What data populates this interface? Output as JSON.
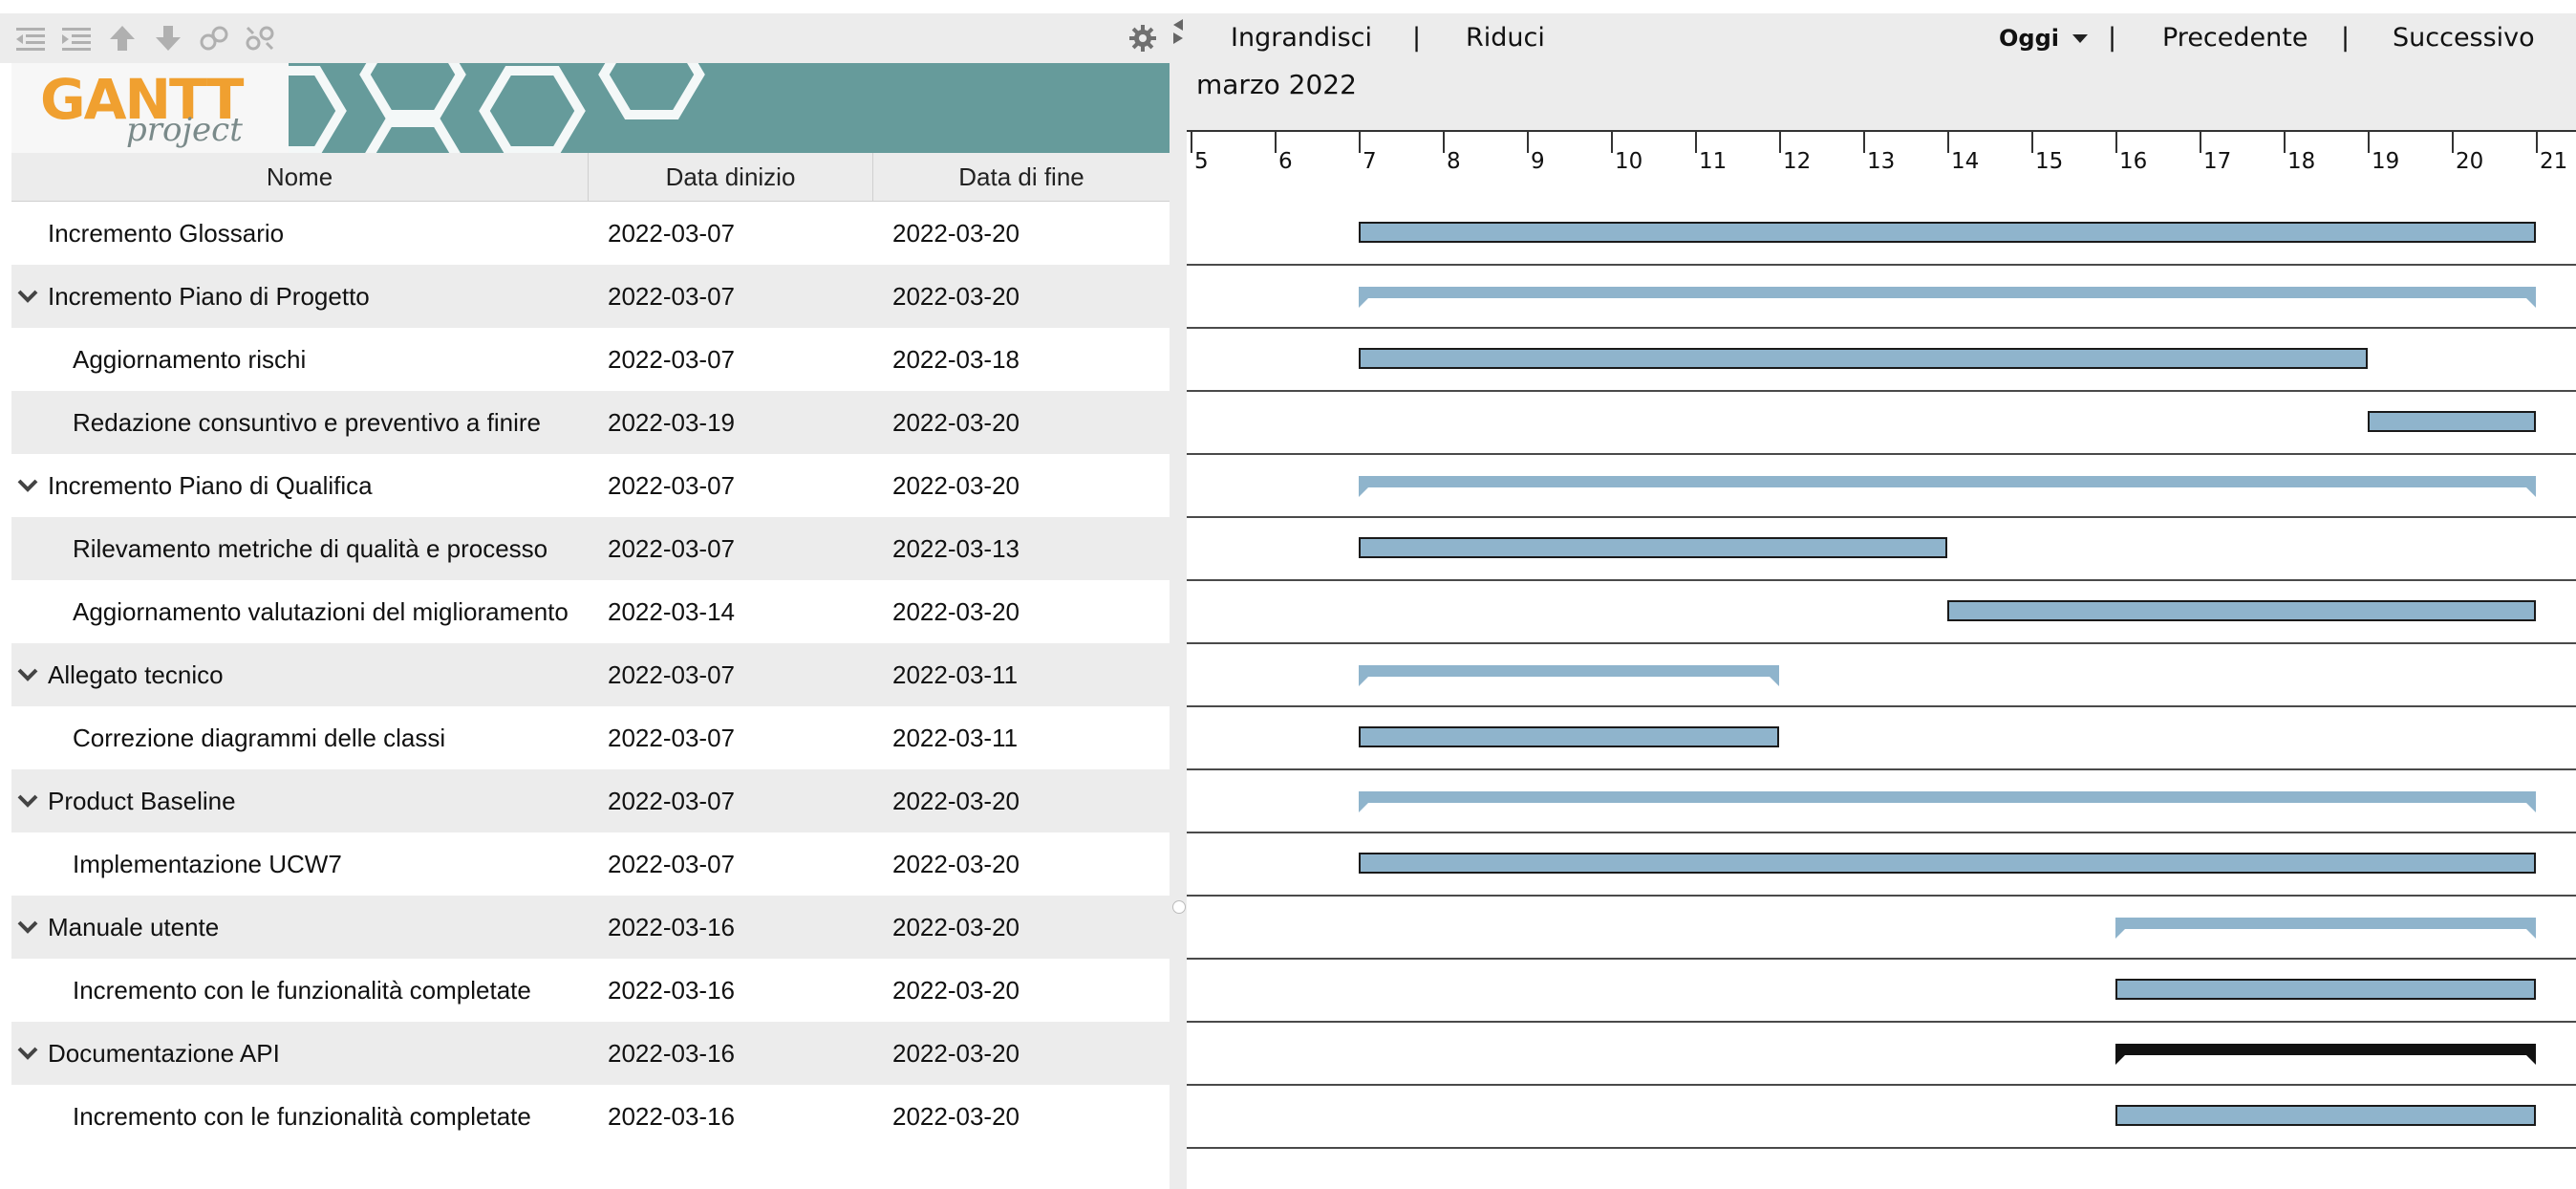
{
  "toolbar": {
    "icons": [
      "outdent-icon",
      "indent-icon",
      "move-up-icon",
      "move-down-icon",
      "link-icon",
      "unlink-icon",
      "gear-icon"
    ]
  },
  "logo": {
    "brand": "GANTT",
    "sub": "project"
  },
  "table": {
    "columns": [
      "Nome",
      "Data dinizio",
      "Data di fine"
    ],
    "rows": [
      {
        "name": "Incremento Glossario",
        "start": "2022-03-07",
        "end": "2022-03-20",
        "level": 0,
        "group": false
      },
      {
        "name": "Incremento Piano di Progetto",
        "start": "2022-03-07",
        "end": "2022-03-20",
        "level": 0,
        "group": true
      },
      {
        "name": "Aggiornamento rischi",
        "start": "2022-03-07",
        "end": "2022-03-18",
        "level": 1,
        "group": false
      },
      {
        "name": "Redazione consuntivo e preventivo a finire",
        "start": "2022-03-19",
        "end": "2022-03-20",
        "level": 1,
        "group": false
      },
      {
        "name": "Incremento Piano di Qualifica",
        "start": "2022-03-07",
        "end": "2022-03-20",
        "level": 0,
        "group": true
      },
      {
        "name": "Rilevamento metriche di qualità e processo",
        "start": "2022-03-07",
        "end": "2022-03-13",
        "level": 1,
        "group": false
      },
      {
        "name": "Aggiornamento valutazioni del miglioramento",
        "start": "2022-03-14",
        "end": "2022-03-20",
        "level": 1,
        "group": false
      },
      {
        "name": "Allegato tecnico",
        "start": "2022-03-07",
        "end": "2022-03-11",
        "level": 0,
        "group": true
      },
      {
        "name": "Correzione diagrammi delle classi",
        "start": "2022-03-07",
        "end": "2022-03-11",
        "level": 1,
        "group": false
      },
      {
        "name": "Product Baseline",
        "start": "2022-03-07",
        "end": "2022-03-20",
        "level": 0,
        "group": true
      },
      {
        "name": "Implementazione UCW7",
        "start": "2022-03-07",
        "end": "2022-03-20",
        "level": 1,
        "group": false
      },
      {
        "name": "Manuale utente",
        "start": "2022-03-16",
        "end": "2022-03-20",
        "level": 0,
        "group": true
      },
      {
        "name": "Incremento con le funzionalità completate",
        "start": "2022-03-16",
        "end": "2022-03-20",
        "level": 1,
        "group": false
      },
      {
        "name": "Documentazione API",
        "start": "2022-03-16",
        "end": "2022-03-20",
        "level": 0,
        "group": true,
        "selected": true
      },
      {
        "name": "Incremento con le funzionalità completate",
        "start": "2022-03-16",
        "end": "2022-03-20",
        "level": 1,
        "group": false
      }
    ]
  },
  "nav": {
    "zoom_in": "Ingrandisci",
    "sep1": "|",
    "zoom_out": "Riduci",
    "today": "Oggi",
    "sep2": "|",
    "previous": "Precedente",
    "sep3": "|",
    "next": "Successivo"
  },
  "timeline": {
    "month": "marzo 2022",
    "days": [
      "5",
      "6",
      "7",
      "8",
      "9",
      "10",
      "11",
      "12",
      "13",
      "14",
      "15",
      "16",
      "17",
      "18",
      "19",
      "20",
      "21"
    ],
    "first_day": 5
  },
  "colors": {
    "bar": "#8fb4cc",
    "bar_border": "#1a1a1a",
    "selected_summary": "#111111",
    "banner": "#669b9b"
  }
}
